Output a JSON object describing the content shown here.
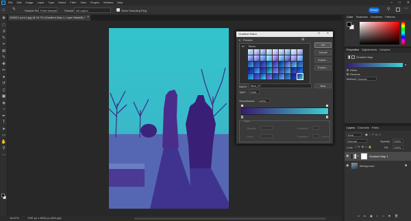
{
  "menubar": {
    "app_icon": "Ps",
    "items": [
      "File",
      "Edit",
      "Image",
      "Layer",
      "Type",
      "Select",
      "Filter",
      "View",
      "Plugins",
      "Window",
      "Help"
    ]
  },
  "options_bar": {
    "sample_size_label": "Sample Size:",
    "sample_size_value": "Point Sample",
    "sample_label": "Sample:",
    "sample_value": "All Layers",
    "show_ring_label": "Show Sampling Ring"
  },
  "top_right": {
    "share_label": "Share"
  },
  "document": {
    "tab_title": "290521-rj-mi-1.jpg @ 16.7% (Gradient Map 1, Layer Mask/8) *",
    "status": "16.67%",
    "dimensions": "7287 px x 8910 px (300 ppi)"
  },
  "gradient_editor": {
    "title": "Gradient Editor",
    "presets_label": "Presets",
    "folder_label": "Blues",
    "buttons": {
      "ok": "OK",
      "cancel": "Cancel",
      "import": "Import...",
      "export": "Export...",
      "new": "New"
    },
    "name_label": "Name:",
    "name_value": "Blue_07",
    "type_label": "Type:",
    "type_value": "Solid",
    "smoothness_label": "Smoothness:",
    "smoothness_value": "100%",
    "stops_label": "Stops",
    "opacity_label": "Opacity:",
    "color_label": "Color:",
    "location_label": "Location:",
    "delete_label": "Delete",
    "gradient_start": "#3a1a74",
    "gradient_end": "#3fd0d0"
  },
  "color_panel": {
    "tabs": [
      "Color",
      "Swatches",
      "Gradients",
      "Patterns"
    ]
  },
  "properties_panel": {
    "tabs": [
      "Properties",
      "Adjustments",
      "Libraries"
    ],
    "layer_type": "Gradient Map",
    "option_dither": "Dither",
    "option_reverse": "Reverse",
    "method_label": "Method:",
    "method_value": "Smooth"
  },
  "layers_panel": {
    "tabs": [
      "Layers",
      "Channels",
      "Paths"
    ],
    "kind_label": "Kind",
    "blend_mode": "Normal",
    "opacity_label": "Opacity:",
    "opacity_value": "100%",
    "lock_label": "Lock:",
    "fill_label": "Fill:",
    "fill_value": "100%",
    "layers": [
      {
        "name": "Gradient Map 1"
      },
      {
        "name": "Background"
      }
    ]
  }
}
